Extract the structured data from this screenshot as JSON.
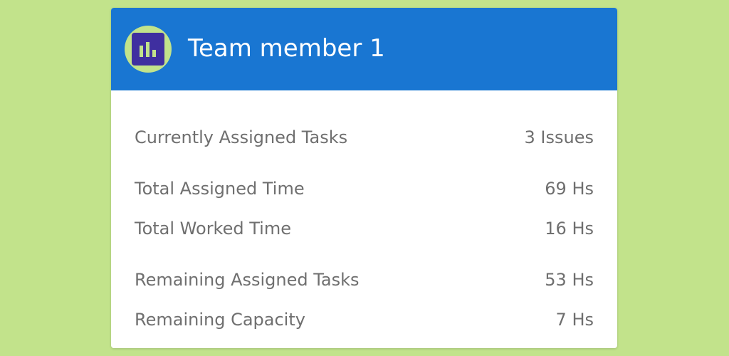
{
  "header": {
    "title": "Team member 1",
    "avatar_icon": "bar-chart-icon"
  },
  "rows": [
    {
      "label": "Currently Assigned Tasks",
      "value": "3 Issues"
    },
    {
      "label": "Total Assigned Time",
      "value": "69 Hs"
    },
    {
      "label": "Total Worked Time",
      "value": "16 Hs"
    },
    {
      "label": "Remaining Assigned Tasks",
      "value": "53 Hs"
    },
    {
      "label": "Remaining Capacity",
      "value": "7 Hs"
    }
  ],
  "colors": {
    "background": "#c2e38b",
    "header": "#1976d2",
    "avatar_ring": "#c2e38b",
    "avatar_fill": "#3f2fa0",
    "icon_bars": "#c2e38b",
    "text": "#6f6f6f"
  }
}
